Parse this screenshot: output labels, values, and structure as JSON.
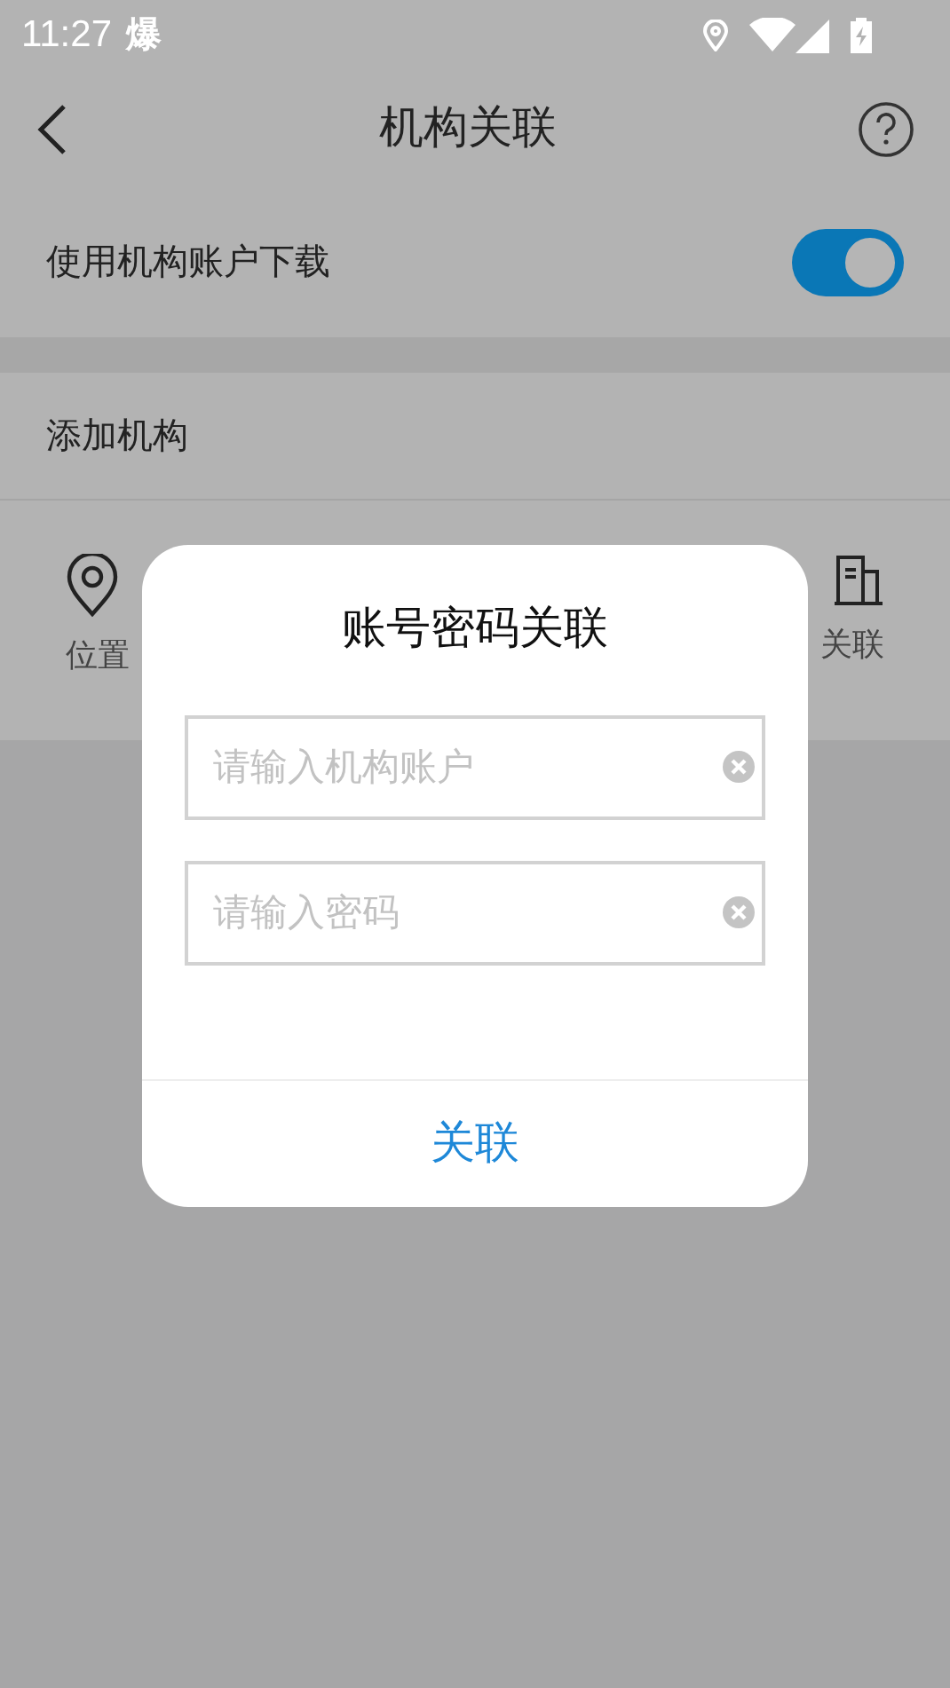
{
  "status_bar": {
    "time": "11:27",
    "notification": "爆"
  },
  "nav": {
    "title": "机构关联"
  },
  "settings": {
    "label": "使用机构账户下载",
    "on": true
  },
  "section": {
    "title": "添加机构"
  },
  "methods": [
    {
      "kind": "location",
      "label": "位置"
    },
    {
      "kind": "building",
      "label": "关联"
    }
  ],
  "dialog": {
    "title": "账号密码关联",
    "fields": [
      {
        "placeholder": "请输入机构账户"
      },
      {
        "placeholder": "请输入密码"
      }
    ],
    "button": "关联"
  }
}
